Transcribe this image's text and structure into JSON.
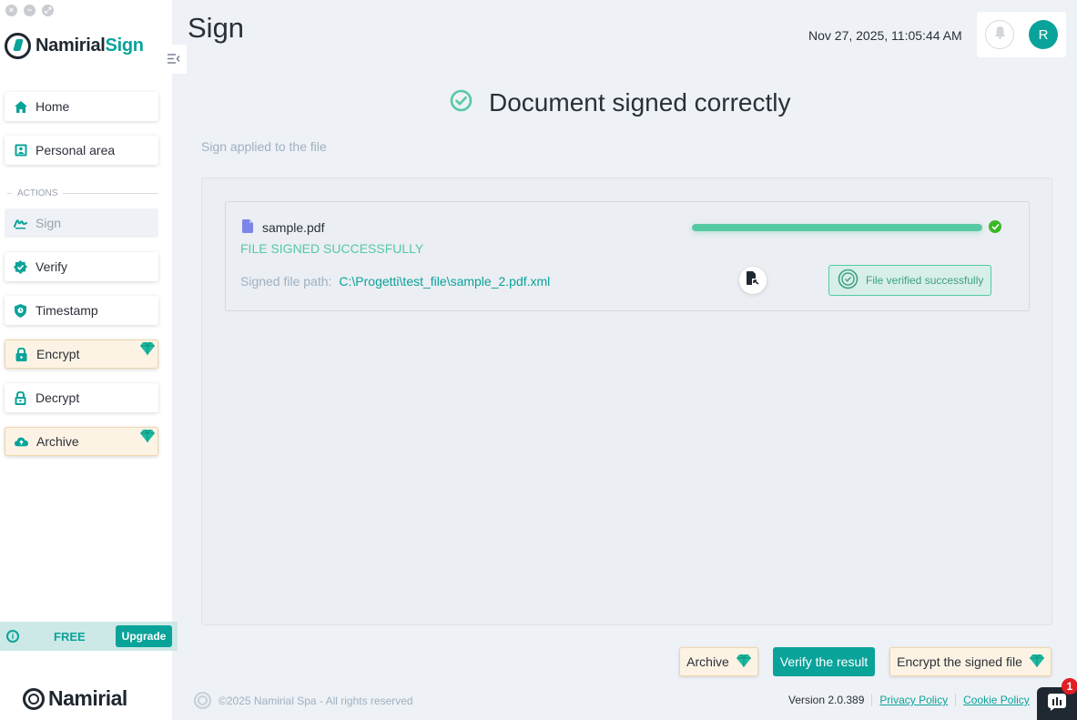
{
  "window": {
    "controls": [
      "×",
      "−",
      "⤢"
    ]
  },
  "sidebar": {
    "logo": {
      "brand": "Namirial",
      "accent": "Sign"
    },
    "nav": [
      {
        "label": "Home",
        "icon": "home-icon"
      },
      {
        "label": "Personal area",
        "icon": "person-card-icon"
      }
    ],
    "section_label": "ACTIONS",
    "actions": [
      {
        "label": "Sign",
        "icon": "signature-icon",
        "active": true
      },
      {
        "label": "Verify",
        "icon": "verified-badge-icon"
      },
      {
        "label": "Timestamp",
        "icon": "shield-clock-icon"
      },
      {
        "label": "Encrypt",
        "icon": "lock-icon",
        "premium": true
      },
      {
        "label": "Decrypt",
        "icon": "unlock-icon"
      },
      {
        "label": "Archive",
        "icon": "cloud-upload-icon",
        "premium": true
      }
    ],
    "plan": {
      "label": "FREE",
      "upgrade": "Upgrade"
    },
    "footer_brand": "Namirial"
  },
  "header": {
    "title": "Sign",
    "datetime": "Nov 27, 2025, 11:05:44 AM",
    "avatar_initial": "R"
  },
  "result": {
    "title": "Document signed correctly",
    "subtitle": "Sign applied to the file"
  },
  "file": {
    "name": "sample.pdf",
    "status": "FILE SIGNED SUCCESSFULLY",
    "path_label": "Signed file path:",
    "path_value": "C:\\Progetti\\test_file\\sample_2.pdf.xml",
    "progress": 1.0,
    "verified_label": "File verified successfully"
  },
  "actions": {
    "archive": "Archive",
    "verify": "Verify the result",
    "encrypt": "Encrypt the signed file"
  },
  "footer": {
    "copyright": "©2025 Namirial Spa - All rights reserved",
    "version": "Version 2.0.389",
    "privacy": "Privacy Policy",
    "cookie": "Cookie Policy",
    "chat_badge": "1"
  },
  "colors": {
    "accent": "#0aa39a",
    "success": "#56c9a3",
    "premium_bg": "#fdf3e4",
    "dark": "#1f2730"
  }
}
